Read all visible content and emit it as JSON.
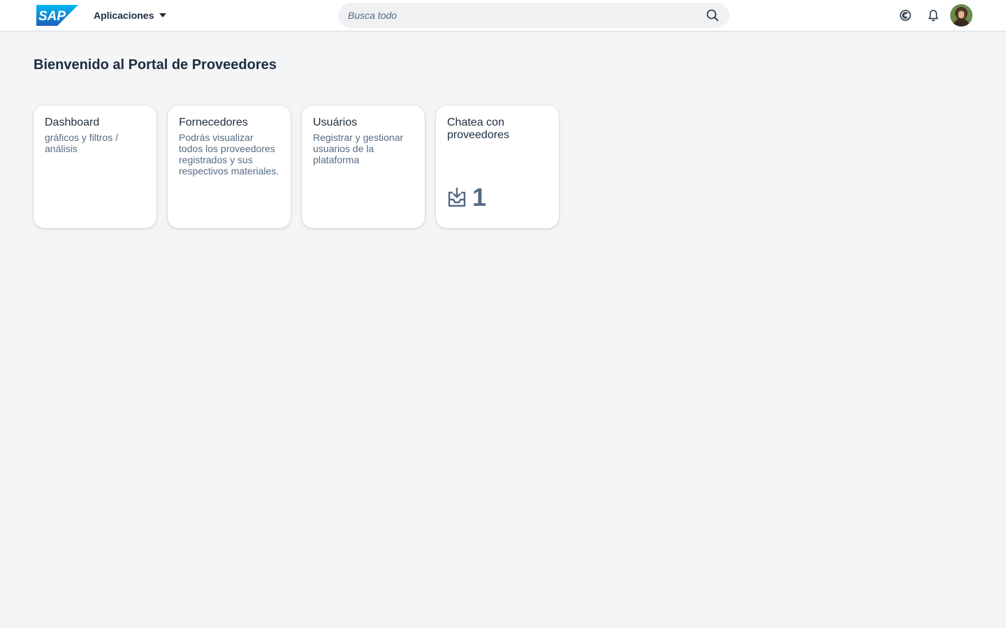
{
  "header": {
    "logo_text": "SAP",
    "app_menu_label": "Aplicaciones",
    "search_placeholder": "Busca todo",
    "icons": [
      "search-icon",
      "copilot-icon",
      "bell-icon",
      "avatar"
    ]
  },
  "page": {
    "title": "Bienvenido al Portal de Proveedores"
  },
  "tiles": [
    {
      "title": "Dashboard",
      "subtitle": "gráficos y filtros / análisis"
    },
    {
      "title": "Fornecedores",
      "subtitle": "Podrás visualizar todos los proveedores registrados y sus respectivos materiales."
    },
    {
      "title": "Usuários",
      "subtitle": "Registrar y gestionar usuarios de la plataforma"
    },
    {
      "title": "Chatea con proveedores",
      "subtitle": "",
      "kpi_icon": "inbox-download-icon",
      "kpi_value": "1"
    }
  ],
  "colors": {
    "background": "#f3f5f7",
    "brand_blue": "#0a6ed1",
    "text_primary": "#1d2d3e",
    "text_secondary": "#556b82"
  }
}
